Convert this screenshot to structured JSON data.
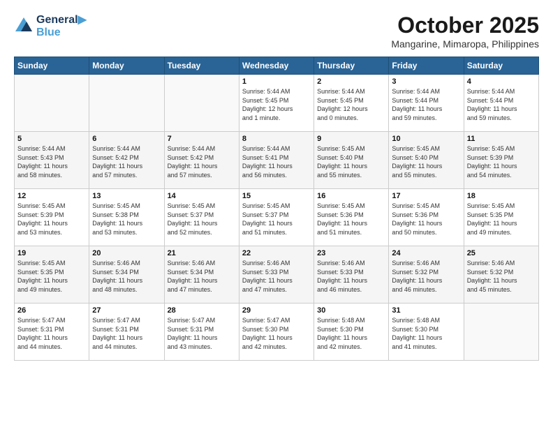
{
  "header": {
    "logo_line1": "General",
    "logo_line2": "Blue",
    "month": "October 2025",
    "location": "Mangarine, Mimaropa, Philippines"
  },
  "days_of_week": [
    "Sunday",
    "Monday",
    "Tuesday",
    "Wednesday",
    "Thursday",
    "Friday",
    "Saturday"
  ],
  "weeks": [
    [
      {
        "day": "",
        "content": ""
      },
      {
        "day": "",
        "content": ""
      },
      {
        "day": "",
        "content": ""
      },
      {
        "day": "1",
        "content": "Sunrise: 5:44 AM\nSunset: 5:45 PM\nDaylight: 12 hours\nand 1 minute."
      },
      {
        "day": "2",
        "content": "Sunrise: 5:44 AM\nSunset: 5:45 PM\nDaylight: 12 hours\nand 0 minutes."
      },
      {
        "day": "3",
        "content": "Sunrise: 5:44 AM\nSunset: 5:44 PM\nDaylight: 11 hours\nand 59 minutes."
      },
      {
        "day": "4",
        "content": "Sunrise: 5:44 AM\nSunset: 5:44 PM\nDaylight: 11 hours\nand 59 minutes."
      }
    ],
    [
      {
        "day": "5",
        "content": "Sunrise: 5:44 AM\nSunset: 5:43 PM\nDaylight: 11 hours\nand 58 minutes."
      },
      {
        "day": "6",
        "content": "Sunrise: 5:44 AM\nSunset: 5:42 PM\nDaylight: 11 hours\nand 57 minutes."
      },
      {
        "day": "7",
        "content": "Sunrise: 5:44 AM\nSunset: 5:42 PM\nDaylight: 11 hours\nand 57 minutes."
      },
      {
        "day": "8",
        "content": "Sunrise: 5:44 AM\nSunset: 5:41 PM\nDaylight: 11 hours\nand 56 minutes."
      },
      {
        "day": "9",
        "content": "Sunrise: 5:45 AM\nSunset: 5:40 PM\nDaylight: 11 hours\nand 55 minutes."
      },
      {
        "day": "10",
        "content": "Sunrise: 5:45 AM\nSunset: 5:40 PM\nDaylight: 11 hours\nand 55 minutes."
      },
      {
        "day": "11",
        "content": "Sunrise: 5:45 AM\nSunset: 5:39 PM\nDaylight: 11 hours\nand 54 minutes."
      }
    ],
    [
      {
        "day": "12",
        "content": "Sunrise: 5:45 AM\nSunset: 5:39 PM\nDaylight: 11 hours\nand 53 minutes."
      },
      {
        "day": "13",
        "content": "Sunrise: 5:45 AM\nSunset: 5:38 PM\nDaylight: 11 hours\nand 53 minutes."
      },
      {
        "day": "14",
        "content": "Sunrise: 5:45 AM\nSunset: 5:37 PM\nDaylight: 11 hours\nand 52 minutes."
      },
      {
        "day": "15",
        "content": "Sunrise: 5:45 AM\nSunset: 5:37 PM\nDaylight: 11 hours\nand 51 minutes."
      },
      {
        "day": "16",
        "content": "Sunrise: 5:45 AM\nSunset: 5:36 PM\nDaylight: 11 hours\nand 51 minutes."
      },
      {
        "day": "17",
        "content": "Sunrise: 5:45 AM\nSunset: 5:36 PM\nDaylight: 11 hours\nand 50 minutes."
      },
      {
        "day": "18",
        "content": "Sunrise: 5:45 AM\nSunset: 5:35 PM\nDaylight: 11 hours\nand 49 minutes."
      }
    ],
    [
      {
        "day": "19",
        "content": "Sunrise: 5:45 AM\nSunset: 5:35 PM\nDaylight: 11 hours\nand 49 minutes."
      },
      {
        "day": "20",
        "content": "Sunrise: 5:46 AM\nSunset: 5:34 PM\nDaylight: 11 hours\nand 48 minutes."
      },
      {
        "day": "21",
        "content": "Sunrise: 5:46 AM\nSunset: 5:34 PM\nDaylight: 11 hours\nand 47 minutes."
      },
      {
        "day": "22",
        "content": "Sunrise: 5:46 AM\nSunset: 5:33 PM\nDaylight: 11 hours\nand 47 minutes."
      },
      {
        "day": "23",
        "content": "Sunrise: 5:46 AM\nSunset: 5:33 PM\nDaylight: 11 hours\nand 46 minutes."
      },
      {
        "day": "24",
        "content": "Sunrise: 5:46 AM\nSunset: 5:32 PM\nDaylight: 11 hours\nand 46 minutes."
      },
      {
        "day": "25",
        "content": "Sunrise: 5:46 AM\nSunset: 5:32 PM\nDaylight: 11 hours\nand 45 minutes."
      }
    ],
    [
      {
        "day": "26",
        "content": "Sunrise: 5:47 AM\nSunset: 5:31 PM\nDaylight: 11 hours\nand 44 minutes."
      },
      {
        "day": "27",
        "content": "Sunrise: 5:47 AM\nSunset: 5:31 PM\nDaylight: 11 hours\nand 44 minutes."
      },
      {
        "day": "28",
        "content": "Sunrise: 5:47 AM\nSunset: 5:31 PM\nDaylight: 11 hours\nand 43 minutes."
      },
      {
        "day": "29",
        "content": "Sunrise: 5:47 AM\nSunset: 5:30 PM\nDaylight: 11 hours\nand 42 minutes."
      },
      {
        "day": "30",
        "content": "Sunrise: 5:48 AM\nSunset: 5:30 PM\nDaylight: 11 hours\nand 42 minutes."
      },
      {
        "day": "31",
        "content": "Sunrise: 5:48 AM\nSunset: 5:30 PM\nDaylight: 11 hours\nand 41 minutes."
      },
      {
        "day": "",
        "content": ""
      }
    ]
  ]
}
